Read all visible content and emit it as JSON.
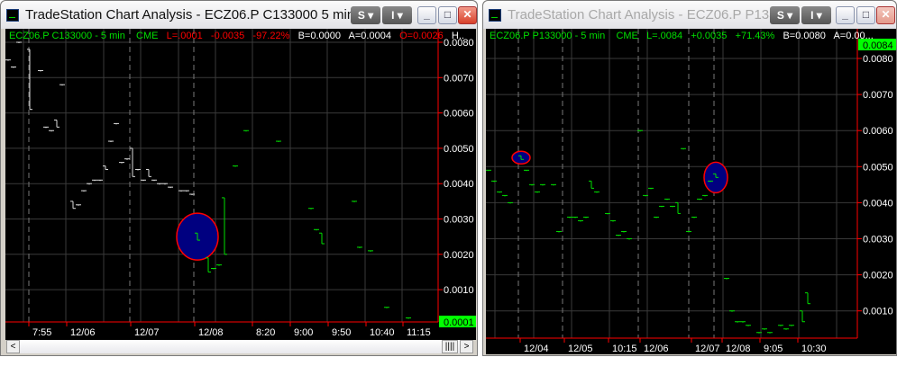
{
  "left_window": {
    "title": "TradeStation Chart Analysis - ECZ06.P C133000  5 min ...",
    "buttons": {
      "s": "S ▾",
      "i": "I ▾",
      "min": "_",
      "max": "□",
      "close": "✕"
    },
    "header": {
      "symbol": "ECZ06.P C133000 - 5 min",
      "exchange": "CME",
      "last": "L=.0001",
      "change": "-0.0035",
      "pct": "-97.22%",
      "bid": "B=0.0000",
      "ask": "A=0.0004",
      "open": "O=0.0026",
      "more": "H.."
    },
    "price_labels": [
      "0.0080",
      "0.0070",
      "0.0060",
      "0.0050",
      "0.0040",
      "0.0030",
      "0.0020",
      "0.0010"
    ],
    "last_price": "0.0001",
    "time_labels": [
      "7:55",
      "12/06",
      "12/07",
      "12/08",
      "8:20",
      "9:00",
      "9:50",
      "10:40",
      "11:15"
    ],
    "scroll_left": "<",
    "scroll_right": ">",
    "scroll_thumb": "||||",
    "bars": [
      [
        1,
        0.0075,
        0.0075
      ],
      [
        2,
        0.0073,
        0.0073
      ],
      [
        3,
        0.008,
        0.008
      ],
      [
        5,
        0.0078,
        0.0061
      ],
      [
        7,
        0.0072,
        0.0072
      ],
      [
        8,
        0.0056,
        0.0056
      ],
      [
        9,
        0.0055,
        0.0055
      ],
      [
        10,
        0.0058,
        0.0056
      ],
      [
        11,
        0.0068,
        0.0068
      ],
      [
        13,
        0.0035,
        0.0033
      ],
      [
        14,
        0.0034,
        0.0034
      ],
      [
        15,
        0.0038,
        0.0038
      ],
      [
        16,
        0.004,
        0.004
      ],
      [
        17,
        0.0041,
        0.0041
      ],
      [
        18,
        0.0041,
        0.0041
      ],
      [
        19,
        0.0045,
        0.0044
      ],
      [
        20,
        0.0052,
        0.0052
      ],
      [
        21,
        0.0057,
        0.0057
      ],
      [
        22,
        0.0046,
        0.0046
      ],
      [
        23,
        0.0047,
        0.0047
      ],
      [
        24,
        0.005,
        0.0042
      ],
      [
        25,
        0.0044,
        0.0044
      ],
      [
        26,
        0.0041,
        0.0041
      ],
      [
        27,
        0.0044,
        0.0042
      ],
      [
        28,
        0.0041,
        0.0041
      ],
      [
        29,
        0.004,
        0.004
      ],
      [
        30,
        0.004,
        0.004
      ],
      [
        31,
        0.0039,
        0.0039
      ],
      [
        33,
        0.0038,
        0.0038
      ],
      [
        34,
        0.0038,
        0.0038
      ],
      [
        35,
        0.0037,
        0.0037
      ],
      [
        36,
        0.0026,
        0.0024
      ],
      [
        38,
        0.0019,
        0.0015
      ],
      [
        39,
        0.0016,
        0.0016
      ],
      [
        40,
        0.0017,
        0.0017
      ],
      [
        41,
        0.0036,
        0.002
      ],
      [
        43,
        0.0045,
        0.0045
      ],
      [
        45,
        0.0055,
        0.0055
      ],
      [
        51,
        0.0052,
        0.0052
      ],
      [
        57,
        0.0033,
        0.0033
      ],
      [
        58,
        0.0027,
        0.0027
      ],
      [
        59,
        0.0026,
        0.0023
      ],
      [
        65,
        0.0035,
        0.0035
      ],
      [
        66,
        0.0022,
        0.0022
      ],
      [
        68,
        0.0021,
        0.0021
      ],
      [
        71,
        0.0005,
        0.0005
      ],
      [
        75,
        0.0002,
        0.0002
      ]
    ],
    "highlight": {
      "bar": 36,
      "price": 0.0025
    }
  },
  "right_window": {
    "title": "TradeStation Chart Analysis - ECZ06.P P133...",
    "buttons": {
      "s": "S ▾",
      "i": "I ▾",
      "min": "_",
      "max": "□",
      "close": "✕"
    },
    "header": {
      "symbol": "ECZ06.P P133000 - 5 min",
      "exchange": "CME",
      "last": "L=.0084",
      "change": "+0.0035",
      "pct": "+71.43%",
      "bid": "B=0.0080",
      "ask": "A=0.00..."
    },
    "price_labels": [
      "0.0080",
      "0.0070",
      "0.0060",
      "0.0050",
      "0.0040",
      "0.0030",
      "0.0020",
      "0.0010"
    ],
    "last_price": "0.0084",
    "time_labels": [
      "12/04",
      "12/05",
      "10:15",
      "12/06",
      "12/07",
      "12/08",
      "9:05",
      "10:30"
    ],
    "bars": [
      [
        1,
        0.0049,
        0.0049
      ],
      [
        2,
        0.0046,
        0.0046
      ],
      [
        3,
        0.0043,
        0.0043
      ],
      [
        4,
        0.0042,
        0.0042
      ],
      [
        5,
        0.004,
        0.004
      ],
      [
        7,
        0.0053,
        0.0052
      ],
      [
        8,
        0.0049,
        0.0049
      ],
      [
        9,
        0.0045,
        0.0045
      ],
      [
        10,
        0.0043,
        0.0043
      ],
      [
        11,
        0.0045,
        0.0045
      ],
      [
        13,
        0.0045,
        0.0045
      ],
      [
        14,
        0.0032,
        0.0032
      ],
      [
        16,
        0.0036,
        0.0036
      ],
      [
        17,
        0.0036,
        0.0036
      ],
      [
        18,
        0.0035,
        0.0035
      ],
      [
        19,
        0.0036,
        0.0036
      ],
      [
        20,
        0.0046,
        0.0044
      ],
      [
        21,
        0.0043,
        0.0043
      ],
      [
        23,
        0.0037,
        0.0037
      ],
      [
        24,
        0.0035,
        0.0035
      ],
      [
        25,
        0.0031,
        0.0031
      ],
      [
        26,
        0.0032,
        0.0032
      ],
      [
        27,
        0.003,
        0.003
      ],
      [
        29,
        0.006,
        0.006
      ],
      [
        30,
        0.0042,
        0.0042
      ],
      [
        31,
        0.0044,
        0.0044
      ],
      [
        32,
        0.0036,
        0.0036
      ],
      [
        33,
        0.0039,
        0.0039
      ],
      [
        34,
        0.0041,
        0.0041
      ],
      [
        35,
        0.0039,
        0.0039
      ],
      [
        36,
        0.004,
        0.0037
      ],
      [
        37,
        0.0055,
        0.0055
      ],
      [
        38,
        0.0032,
        0.0032
      ],
      [
        39,
        0.0036,
        0.0036
      ],
      [
        40,
        0.0041,
        0.0041
      ],
      [
        41,
        0.0042,
        0.0042
      ],
      [
        42,
        0.0046,
        0.0046
      ],
      [
        43,
        0.0048,
        0.0047
      ],
      [
        45,
        0.0019,
        0.0019
      ],
      [
        46,
        0.001,
        0.001
      ],
      [
        47,
        0.0007,
        0.0007
      ],
      [
        48,
        0.0007,
        0.0007
      ],
      [
        49,
        0.0006,
        0.0006
      ],
      [
        51,
        0.0004,
        0.0004
      ],
      [
        52,
        0.0005,
        0.0005
      ],
      [
        53,
        0.0004,
        0.0004
      ],
      [
        55,
        0.0006,
        0.0006
      ],
      [
        56,
        0.0005,
        0.0005
      ],
      [
        57,
        0.0006,
        0.0006
      ],
      [
        59,
        0.001,
        0.0007
      ],
      [
        60,
        0.0015,
        0.0012
      ]
    ],
    "highlights": [
      {
        "bar": 7,
        "price": 0.00525,
        "size": "small"
      },
      {
        "bar": 43,
        "price": 0.0047,
        "size": "large"
      }
    ]
  },
  "colors": {
    "bar": "#00e000",
    "axis": "#ff0000",
    "grid": "#3a3a3a",
    "highlight_fill": "#000080",
    "highlight_stroke": "#ff0000",
    "last_bg": "#00ff00"
  }
}
